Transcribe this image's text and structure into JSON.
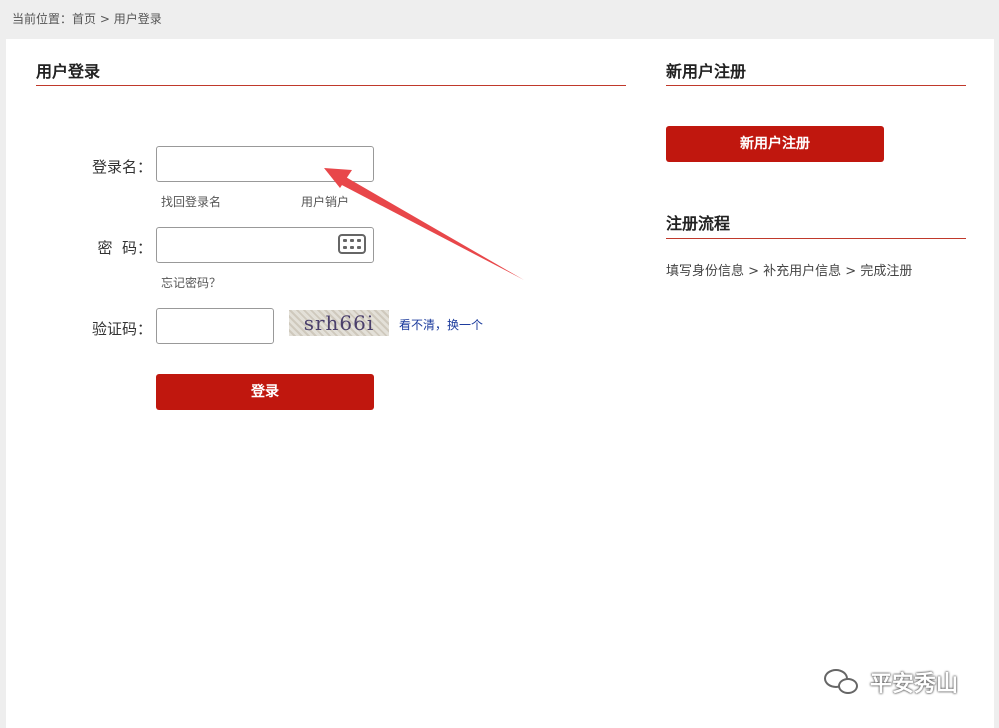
{
  "breadcrumb": {
    "prefix": "当前位置：",
    "home": "首页",
    "sep": " > ",
    "current": "用户登录"
  },
  "login": {
    "title": "用户登录",
    "username_label": "登录名：",
    "find_username": "找回登录名",
    "cancel_account": "用户销户",
    "password_label": "密  码：",
    "forgot_password": "忘记密码？",
    "captcha_label": "验证码：",
    "captcha_text": "srh66i",
    "refresh_captcha": "看不清，换一个",
    "submit": "登录"
  },
  "register": {
    "title": "新用户注册",
    "button": "新用户注册"
  },
  "process": {
    "title": "注册流程",
    "steps": "填写身份信息 > 补充用户信息 > 完成注册"
  },
  "watermark": {
    "text": "平安秀山",
    "icon": "wechat-icon"
  },
  "colors": {
    "accent": "#c0170e",
    "rule": "#c0392b",
    "link": "#1a3a9c",
    "annotation_arrow": "#e8474a"
  }
}
